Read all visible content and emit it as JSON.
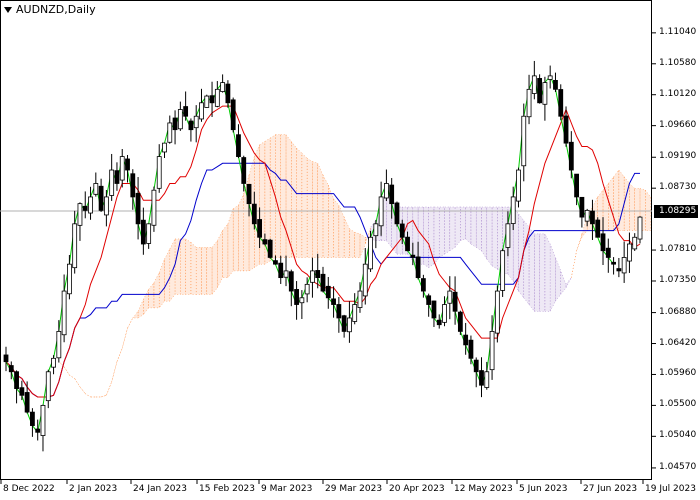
{
  "window": {
    "title": "AUDNZD,Daily"
  },
  "colors": {
    "background": "#ffffff",
    "candle": "#000000",
    "tenkan": "#e00000",
    "kijun": "#0000cc",
    "chikou": "#00cc00",
    "cloud_bull": "#ff8c40",
    "cloud_bear": "#a27ec8",
    "price_line": "#b0b0b0"
  },
  "current_price": "1.08295",
  "chart_data": {
    "type": "line",
    "title": "AUDNZD,Daily",
    "ylim": [
      1.0445,
      1.1135
    ],
    "price_ticks": [
      "1.11040",
      "1.10580",
      "1.10120",
      "1.09660",
      "1.09190",
      "1.08730",
      "1.08295",
      "1.07810",
      "1.07350",
      "1.06880",
      "1.06420",
      "1.05960",
      "1.05500",
      "1.05040",
      "1.04570"
    ],
    "date_ticks": [
      "8 Dec 2022",
      "2 Jan 2023",
      "24 Jan 2023",
      "15 Feb 2023",
      "9 Mar 2023",
      "29 Mar 2023",
      "20 Apr 2023",
      "12 May 2023",
      "5 Jun 2023",
      "27 Jun 2023",
      "19 Jul 2023"
    ],
    "closes": [
      1.0615,
      1.06,
      1.0575,
      1.0565,
      1.054,
      1.052,
      1.051,
      1.055,
      1.06,
      1.062,
      1.066,
      1.072,
      1.076,
      1.082,
      1.085,
      1.084,
      1.086,
      1.088,
      1.084,
      1.086,
      1.09,
      1.088,
      1.092,
      1.09,
      1.086,
      1.082,
      1.079,
      1.082,
      1.087,
      1.092,
      1.094,
      1.097,
      1.096,
      1.099,
      1.098,
      1.096,
      1.098,
      1.1,
      1.101,
      1.1,
      1.102,
      1.103,
      1.1,
      1.096,
      1.092,
      1.088,
      1.085,
      1.082,
      1.08,
      1.079,
      1.077,
      1.076,
      1.074,
      1.075,
      1.072,
      1.07,
      1.071,
      1.073,
      1.075,
      1.074,
      1.072,
      1.071,
      1.07,
      1.068,
      1.066,
      1.068,
      1.07,
      1.072,
      1.076,
      1.08,
      1.082,
      1.086,
      1.088,
      1.085,
      1.082,
      1.08,
      1.078,
      1.077,
      1.074,
      1.072,
      1.07,
      1.068,
      1.067,
      1.07,
      1.072,
      1.069,
      1.066,
      1.064,
      1.062,
      1.06,
      1.058,
      1.06,
      1.066,
      1.072,
      1.078,
      1.082,
      1.086,
      1.09,
      1.098,
      1.102,
      1.104,
      1.1,
      1.103,
      1.104,
      1.102,
      1.098,
      1.094,
      1.09,
      1.086,
      1.083,
      1.084,
      1.082,
      1.08,
      1.078,
      1.077,
      1.076,
      1.075,
      1.077,
      1.079,
      1.08,
      1.083
    ]
  },
  "x_labels": [
    "8 Dec 2022",
    "2 Jan 2023",
    "24 Jan 2023",
    "15 Feb 2023",
    "9 Mar 2023",
    "29 Mar 2023",
    "20 Apr 2023",
    "12 May 2023",
    "5 Jun 2023",
    "27 Jun 2023",
    "19 Jul 2023"
  ],
  "y_labels": [
    "1.11040",
    "1.10580",
    "1.10120",
    "1.09660",
    "1.09190",
    "1.08730",
    "1.07810",
    "1.07350",
    "1.06880",
    "1.06420",
    "1.05960",
    "1.05500",
    "1.05040",
    "1.04570"
  ]
}
